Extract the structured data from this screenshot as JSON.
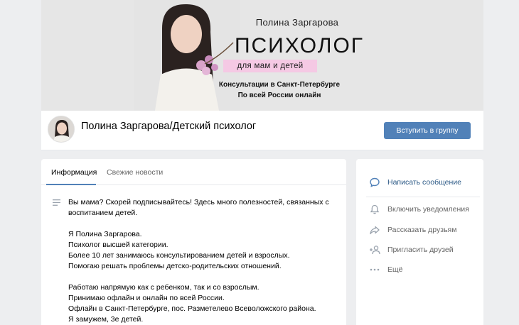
{
  "cover": {
    "name": "Полина Заргарова",
    "title": "ПСИХОЛОГ",
    "badge": "для мам и детей",
    "line1": "Консультации в Санкт-Петербурге",
    "line2": "По всей России онлайн"
  },
  "header": {
    "group_name": "Полина Заргарова/Детский психолог",
    "join_label": "Вступить в группу"
  },
  "tabs": [
    {
      "label": "Информация",
      "active": true
    },
    {
      "label": "Свежие новости",
      "active": false
    }
  ],
  "description": "Вы мама? Скорей подписывайтесь! Здесь много полезностей, связанных с воспитанием детей.\n\nЯ Полина Заргарова.\nПсихолог высшей категории.\nБолее 10 лет занимаюсь консультированием детей и взрослых.\nПомогаю решать проблемы детско-родительских отношений.\n\nРаботаю напрямую как с ребенком, так и со взрослым.\nПринимаю офлайн и онлайн по всей России.\nОфлайн в Санкт-Петербурге, пос. Разметелево Всеволожского района.\nЯ замужем, 3е детей.",
  "side": {
    "write_message": "Написать сообщение",
    "notifications": "Включить уведомления",
    "share": "Рассказать друзьям",
    "invite": "Пригласить друзей",
    "more": "Ещё"
  },
  "icons": {
    "write_message": "chat-bubble-icon",
    "notifications": "bell-icon",
    "share": "share-arrow-icon",
    "invite": "add-person-icon",
    "more": "dots-icon",
    "description": "text-lines-icon"
  },
  "colors": {
    "accent": "#5181b8",
    "link": "#2a5885",
    "background": "#edeef0",
    "badge": "#f5c9e4"
  }
}
